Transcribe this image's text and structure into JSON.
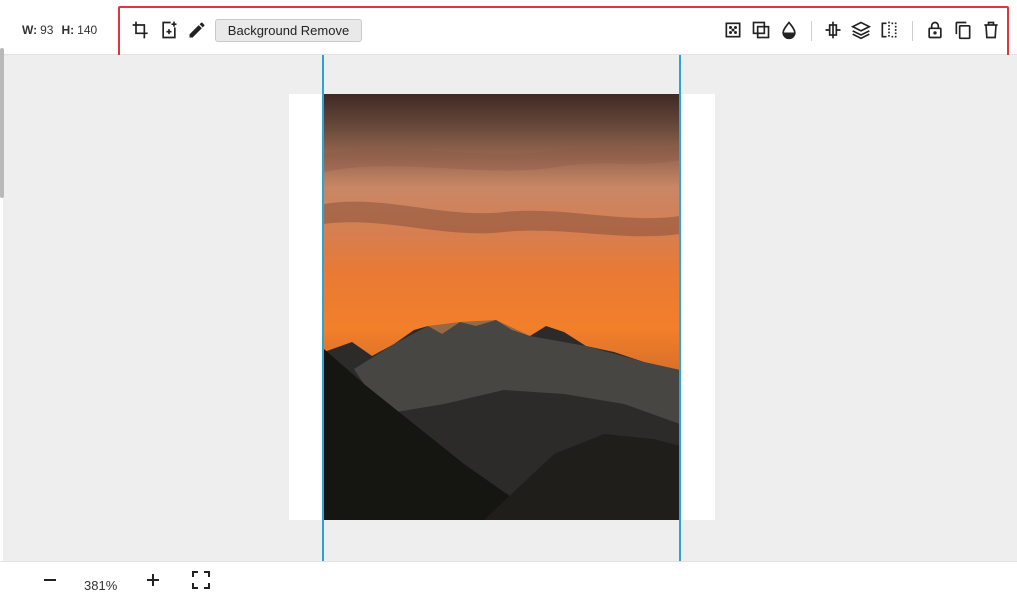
{
  "dimensions": {
    "w_label": "W:",
    "w_value": "93",
    "h_label": "H:",
    "h_value": "140"
  },
  "toolbar": {
    "background_remove_label": "Background Remove",
    "left_tools": [
      "crop-icon",
      "add-image-icon",
      "pencil-icon"
    ],
    "right_tools": [
      "pattern-icon",
      "overlap-icon",
      "opacity-drop-icon",
      "align-icon",
      "layers-icon",
      "flip-icon",
      "lock-icon",
      "duplicate-icon",
      "trash-icon"
    ]
  },
  "zoom": {
    "value": "381%"
  },
  "colors": {
    "highlight": "#e0353a",
    "guide": "#2aa3d6",
    "canvas": "#eeeeee"
  }
}
